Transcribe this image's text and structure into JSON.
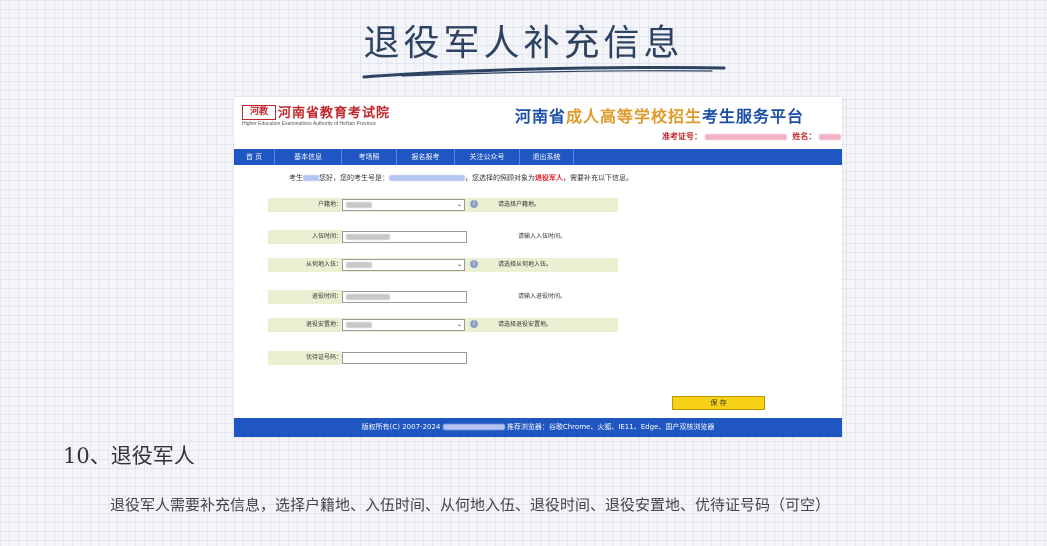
{
  "doc_title": "退役军人补充信息",
  "portal": {
    "logo_text": "河教",
    "inst_name_cn": "河南省教育考试院",
    "inst_name_en": "Higher Education Examinations Authority of HeNan Province",
    "platform": {
      "part1": "河南省",
      "part2": "成人高等学校招生",
      "part3": "考生服务平台"
    },
    "exam_no_label": "准考证号：",
    "name_label": "姓名：",
    "nav": [
      "首 页",
      "基本信息",
      "考场照",
      "报名报考",
      "关注公众号",
      "退出系统"
    ],
    "notice": {
      "pre": "考生",
      "greeting": "您好，您的考生号是：",
      "mid": "，您选择的照顾对象为",
      "target": "退役军人",
      "post": "，需要补充以下信息。"
    },
    "fields": {
      "hukou": {
        "label": "户籍地：",
        "hint": "请选择户籍地。"
      },
      "enlist_time": {
        "label": "入伍时间：",
        "hint": "请输入入伍时间。"
      },
      "enlist_place": {
        "label": "从何地入伍：",
        "hint": "请选择从何地入伍。"
      },
      "retire_time": {
        "label": "退役时间：",
        "hint": "请输入退役时间。"
      },
      "settle_place": {
        "label": "退役安置地：",
        "hint": "请选择退役安置地。"
      },
      "cert_no": {
        "label": "优待证号码："
      }
    },
    "save_label": "保 存",
    "footer": {
      "copyright": "版权所有(C) 2007-2024",
      "browsers": "推荐浏览器：谷歌Chrome、火狐、IE11、Edge、国产双核浏览器"
    }
  },
  "section_heading": "10、退役军人",
  "section_desc": "退役军人需要补充信息，选择户籍地、入伍时间、从何地入伍、退役时间、退役安置地、优待证号码（可空）",
  "colors": {
    "nav_blue": "#1f56c2",
    "title_navy": "#2e4362",
    "accent_red": "#c0272d",
    "save_yellow": "#f7d117"
  }
}
